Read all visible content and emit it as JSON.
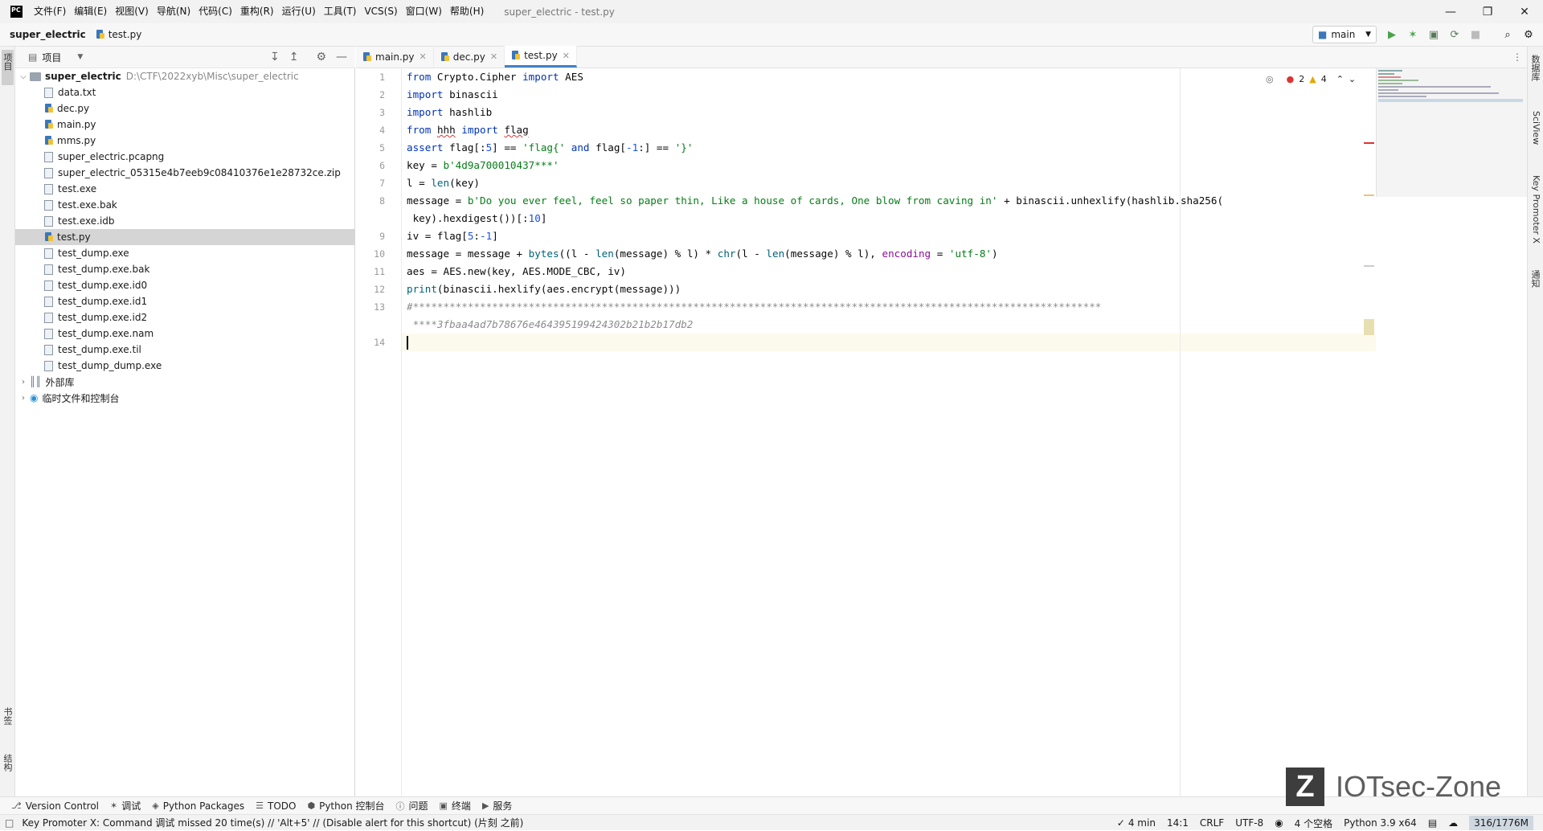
{
  "menu": {
    "app_logo": "PC",
    "items": [
      "文件(F)",
      "编辑(E)",
      "视图(V)",
      "导航(N)",
      "代码(C)",
      "重构(R)",
      "运行(U)",
      "工具(T)",
      "VCS(S)",
      "窗口(W)",
      "帮助(H)"
    ],
    "window_title": "super_electric - test.py"
  },
  "breadcrumb": {
    "project": "super_electric",
    "file": "test.py"
  },
  "run_config": {
    "label": "main"
  },
  "left_strip": {
    "project_tab": "项目",
    "bookmarks_tab": "书签",
    "structure_tab": "结构"
  },
  "project_panel": {
    "header": "项目",
    "root_name": "super_electric",
    "root_path": "D:\\CTF\\2022xyb\\Misc\\super_electric",
    "files": [
      "data.txt",
      "dec.py",
      "main.py",
      "mms.py",
      "super_electric.pcapng",
      "super_electric_05315e4b7eeb9c08410376e1e28732ce.zip",
      "test.exe",
      "test.exe.bak",
      "test.exe.idb",
      "test.py",
      "test_dump.exe",
      "test_dump.exe.bak",
      "test_dump.exe.id0",
      "test_dump.exe.id1",
      "test_dump.exe.id2",
      "test_dump.exe.nam",
      "test_dump.exe.til",
      "test_dump_dump.exe"
    ],
    "selected": "test.py",
    "external_libs": "外部库",
    "scratches": "临时文件和控制台"
  },
  "tabs": [
    {
      "label": "main.py"
    },
    {
      "label": "dec.py"
    },
    {
      "label": "test.py"
    }
  ],
  "editor": {
    "line_numbers": [
      "1",
      "2",
      "3",
      "4",
      "5",
      "6",
      "7",
      "8",
      "",
      "9",
      "10",
      "11",
      "12",
      "13",
      "",
      "14"
    ],
    "errors": "2",
    "warnings": "4"
  },
  "right_strip": {
    "tab1": "数据库",
    "tab2": "SciView",
    "tab3": "Key Promoter X",
    "tab4": "通知"
  },
  "tool_windows": [
    "Version Control",
    "调试",
    "Python Packages",
    "TODO",
    "Python 控制台",
    "问题",
    "终端",
    "服务"
  ],
  "status": {
    "message": "Key Promoter X: Command 调试 missed 20 time(s) // 'Alt+5' // (Disable alert for this shortcut) (片刻 之前)",
    "time": "4 min",
    "position": "14:1",
    "line_sep": "CRLF",
    "encoding": "UTF-8",
    "indent": "4 个空格",
    "interpreter": "Python 3.9 x64",
    "memory": "316/1776M"
  },
  "watermark": {
    "logo": "Z",
    "text": "IOTsec-Zone"
  }
}
